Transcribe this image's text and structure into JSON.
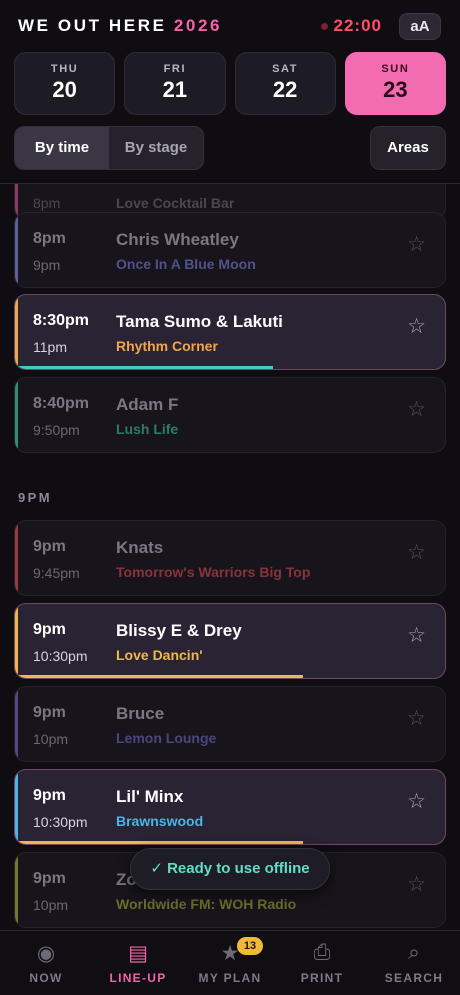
{
  "header": {
    "brand": "WE OUT HERE",
    "year": "2026",
    "clock": "22:00",
    "text_size_button": "aA"
  },
  "days": [
    {
      "name": "THU",
      "date": "20",
      "active": false
    },
    {
      "name": "FRI",
      "date": "21",
      "active": false
    },
    {
      "name": "SAT",
      "date": "22",
      "active": false
    },
    {
      "name": "SUN",
      "date": "23",
      "active": true
    }
  ],
  "view": {
    "by_time": "By time",
    "by_stage": "By stage",
    "areas": "Areas"
  },
  "list": {
    "partial_top": {
      "time": "8pm",
      "name": "Love Cocktail Bar"
    },
    "section": "9PM",
    "items": [
      {
        "start": "8pm",
        "end": "9pm",
        "artist": "Chris Wheatley",
        "stage": "Once In A Blue Moon",
        "color": "#5b5f9e",
        "highlight": false
      },
      {
        "start": "8:30pm",
        "end": "11pm",
        "artist": "Tama Sumo & Lakuti",
        "stage": "Rhythm Corner",
        "color": "#f0a64a",
        "highlight": true,
        "progress": 0.6,
        "progress_color": "#4fc7c4"
      },
      {
        "start": "8:40pm",
        "end": "9:50pm",
        "artist": "Adam F",
        "stage": "Lush Life",
        "color": "#2e8f75",
        "highlight": false
      },
      {
        "start": "9pm",
        "end": "9:45pm",
        "artist": "Knats",
        "stage": "Tomorrow's Warriors Big Top",
        "color": "#9a3a3f",
        "highlight": false
      },
      {
        "start": "9pm",
        "end": "10:30pm",
        "artist": "Blissy E & Drey",
        "stage": "Love Dancin'",
        "color": "#f0b84a",
        "highlight": true,
        "progress": 0.67,
        "progress_color": "#f0b84a"
      },
      {
        "start": "9pm",
        "end": "10pm",
        "artist": "Bruce",
        "stage": "Lemon Lounge",
        "color": "#4f4a86",
        "highlight": false
      },
      {
        "start": "9pm",
        "end": "10:30pm",
        "artist": "Lil' Minx",
        "stage": "Brawnswood",
        "color": "#4ab6e6",
        "highlight": true,
        "progress": 0.67,
        "progress_color": "#f0b84a"
      },
      {
        "start": "9pm",
        "end": "10pm",
        "artist": "Zo... Discos",
        "stage": "Worldwide FM: WOH Radio",
        "color": "#6f7a2a",
        "highlight": false
      }
    ]
  },
  "toast": "✓ Ready to use offline",
  "tabs": [
    {
      "label": "NOW",
      "icon": "now-icon",
      "glyph": "◉",
      "active": false
    },
    {
      "label": "LINE-UP",
      "icon": "lineup-icon",
      "glyph": "▤",
      "active": true
    },
    {
      "label": "MY PLAN",
      "icon": "star-icon",
      "glyph": "★",
      "active": false,
      "badge": "13"
    },
    {
      "label": "PRINT",
      "icon": "print-icon",
      "glyph": "⎙",
      "active": false
    },
    {
      "label": "SEARCH",
      "icon": "search-icon",
      "glyph": "⌕",
      "active": false
    }
  ]
}
